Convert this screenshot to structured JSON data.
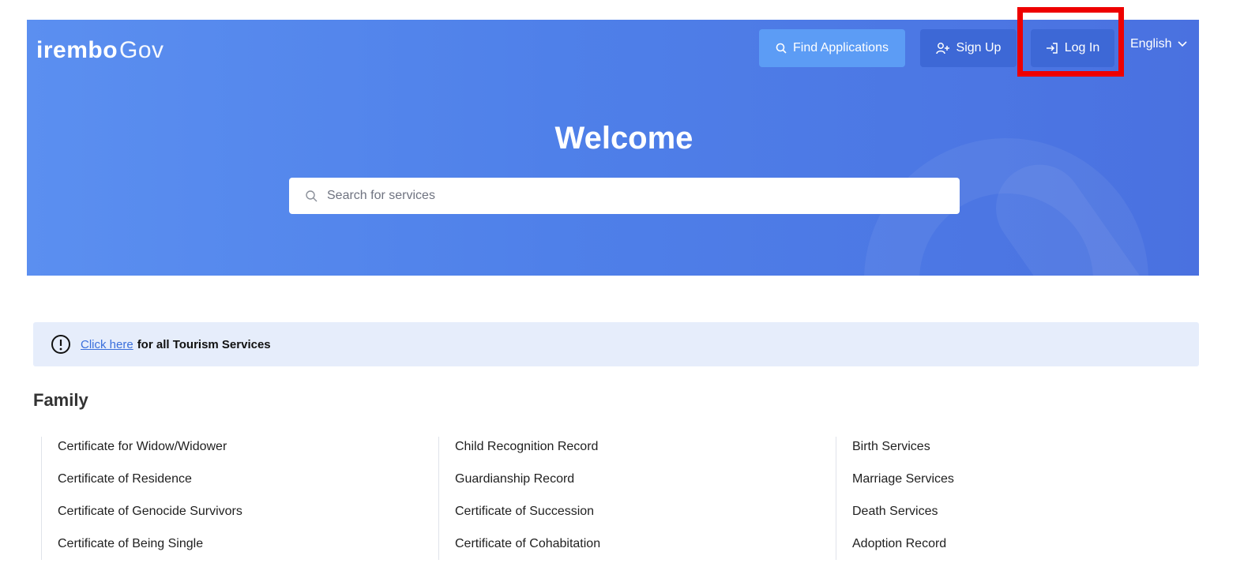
{
  "header": {
    "logo_brand": "irembo",
    "logo_suffix": "Gov",
    "find_label": "Find Applications",
    "signup_label": "Sign Up",
    "login_label": "Log In",
    "language_label": "English"
  },
  "hero": {
    "title": "Welcome",
    "search_placeholder": "Search for services"
  },
  "banner": {
    "link_text": "Click here",
    "text": "for all Tourism Services"
  },
  "family": {
    "title": "Family",
    "columns": [
      [
        "Certificate for Widow/Widower",
        "Certificate of Residence",
        "Certificate of Genocide Survivors",
        "Certificate of Being Single"
      ],
      [
        "Child Recognition Record",
        "Guardianship Record",
        "Certificate of Succession",
        "Certificate of Cohabitation"
      ],
      [
        "Birth Services",
        "Marriage Services",
        "Death Services",
        "Adoption Record"
      ]
    ]
  },
  "colors": {
    "hero": "#4f80e9",
    "find_button": "#5c9cf5",
    "nav_button": "#3d68d6",
    "highlight": "#ee0000",
    "banner": "#e6edfb"
  },
  "icons": [
    "search-icon",
    "add-user-icon",
    "login-arrow-icon",
    "chevron-down-icon",
    "info-icon"
  ]
}
